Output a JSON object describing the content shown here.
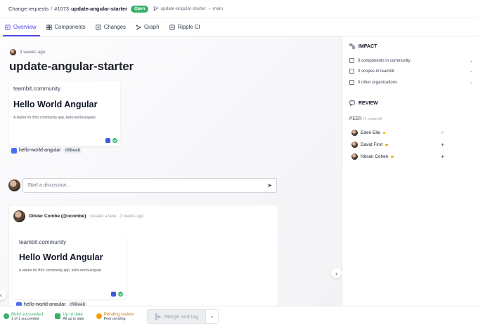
{
  "breadcrumb": {
    "section": "Change requests",
    "separator": "/",
    "number": "#1073",
    "title": "update-angular-starter",
    "status": "Open",
    "branch": "update-angular-starter → main"
  },
  "tabs": [
    {
      "label": "Overview",
      "icon": "overview-icon",
      "active": true
    },
    {
      "label": "Components",
      "icon": "components-icon",
      "active": false
    },
    {
      "label": "Changes",
      "icon": "changes-icon",
      "active": false
    },
    {
      "label": "Graph",
      "icon": "graph-icon",
      "active": false
    },
    {
      "label": "Ripple CI",
      "icon": "ripple-icon",
      "active": false
    }
  ],
  "cr": {
    "time": "3 weeks ago",
    "title": "update-angular-starter"
  },
  "preview": {
    "scope": "teambit.community",
    "heading": "Hello World Angular",
    "description": "A starter for Bit's community app, hello-world-angular."
  },
  "component_chip": {
    "name": "hello-world-angular",
    "hash": "d98eeb"
  },
  "discussion": {
    "placeholder": "Start a discussion...",
    "send_icon": "send-icon"
  },
  "thread": {
    "author": "Olivier Combe (@ocombe)",
    "meta": "created a lane · 3 weeks ago",
    "scope": "teambit.community",
    "heading": "Hello World Angular",
    "description": "A starter for Bit's community app, hello-world-angular.",
    "chip_name": "hello-world-angular",
    "chip_hash": "d98eeb"
  },
  "impact": {
    "title": "IMPACT",
    "rows": [
      {
        "label": "0 components in community",
        "icon": "components-icon"
      },
      {
        "label": "0 scopes in teambit",
        "icon": "scope-icon"
      },
      {
        "label": "0 other organizations",
        "icon": "org-icon"
      }
    ]
  },
  "review": {
    "title": "REVIEW",
    "peer_label": "PEER",
    "peer_required": "(1 required)",
    "reviewers": [
      {
        "name": "Eden Elle",
        "action": "✓"
      },
      {
        "name": "David First",
        "action": "+"
      },
      {
        "name": "Nitsan Cohen",
        "action": "+"
      }
    ]
  },
  "status": {
    "build_title": "Build succeeded",
    "build_sub": "1 of 1 succeeded",
    "uptodate_title": "Up to date",
    "uptodate_sub": "All up to date",
    "review_title": "Pending review",
    "review_sub": "Peer pending",
    "merge_label": "Merge and tag",
    "colors": {
      "success": "#37b26c",
      "pending": "#d97706",
      "accent": "#4f46e5"
    }
  }
}
